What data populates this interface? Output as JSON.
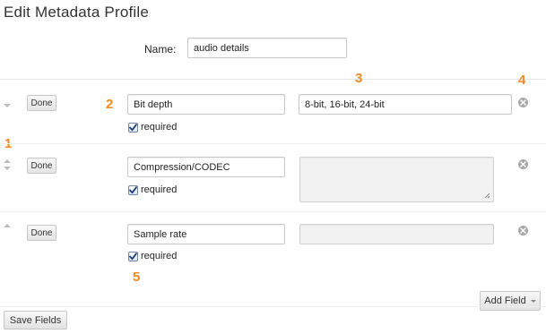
{
  "page": {
    "title": "Edit Metadata Profile",
    "name_label": "Name:",
    "name_value": "audio details"
  },
  "fields": [
    {
      "done_label": "Done",
      "name_value": "Bit depth",
      "values_value": "8-bit, 16-bit, 24-bit",
      "required_label": "required",
      "required_checked": true
    },
    {
      "done_label": "Done",
      "name_value": "Compression/CODEC",
      "values_value": "",
      "required_label": "required",
      "required_checked": true
    },
    {
      "done_label": "Done",
      "name_value": "Sample rate",
      "values_value": "",
      "required_label": "required",
      "required_checked": true
    }
  ],
  "callouts": [
    "1",
    "2",
    "3",
    "4",
    "5"
  ],
  "actions": {
    "add_field_label": "Add Field",
    "save_fields_label": "Save Fields"
  },
  "colors": {
    "callout": "#f08a24",
    "remove_icon": "#a8a8a8",
    "checkbox_border": "#6f86a8"
  },
  "icons": {
    "reorder_up": "arrow-up-icon",
    "reorder_down": "arrow-down-icon",
    "remove": "remove-circle-icon",
    "check": "checkmark-icon",
    "dropdown": "caret-down-icon"
  }
}
